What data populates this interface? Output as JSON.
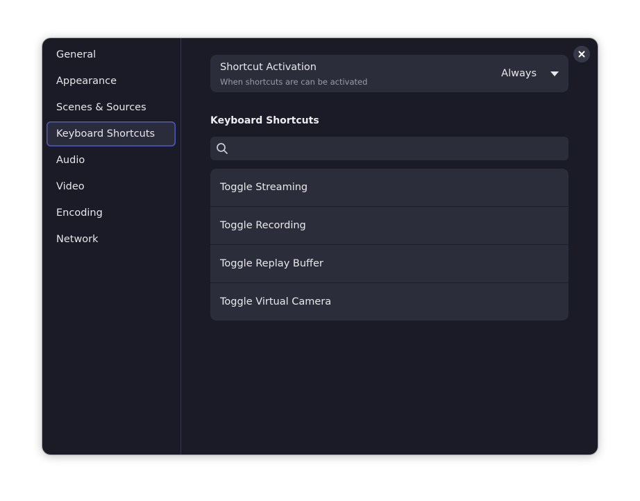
{
  "sidebar": {
    "items": [
      {
        "label": "General"
      },
      {
        "label": "Appearance"
      },
      {
        "label": "Scenes & Sources"
      },
      {
        "label": "Keyboard Shortcuts",
        "active": true
      },
      {
        "label": "Audio"
      },
      {
        "label": "Video"
      },
      {
        "label": "Encoding"
      },
      {
        "label": "Network"
      }
    ]
  },
  "main": {
    "activation": {
      "title": "Shortcut Activation",
      "subtitle": "When shortcuts are can be activated",
      "value": "Always"
    },
    "section_heading": "Keyboard Shortcuts",
    "search": {
      "value": "",
      "placeholder": ""
    },
    "shortcuts": [
      {
        "label": "Toggle Streaming"
      },
      {
        "label": "Toggle Recording"
      },
      {
        "label": "Toggle Replay Buffer"
      },
      {
        "label": "Toggle Virtual Camera"
      }
    ]
  },
  "icons": {
    "close": "close-icon",
    "dropdown": "chevron-down-icon",
    "search": "search-icon"
  },
  "colors": {
    "window_bg": "#1a1b26",
    "card_bg": "#2c2d3a",
    "active_border": "#4e5bb8",
    "text": "#e8e8ec",
    "subtext": "#9a9caa"
  }
}
